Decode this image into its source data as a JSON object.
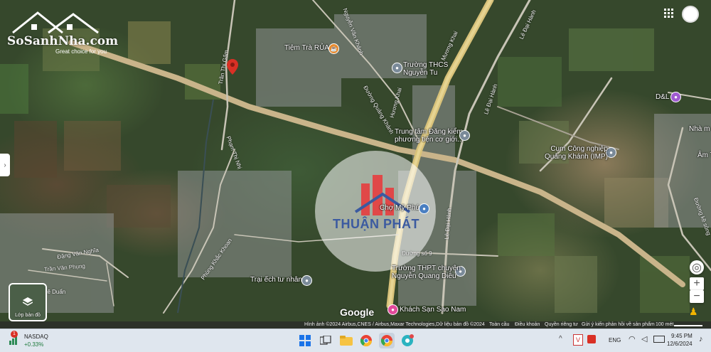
{
  "logo": {
    "brand": "SoSanhNha.com",
    "tagline": "Great choice for you"
  },
  "watermark": {
    "brand": "THUẬN PHÁT"
  },
  "places": {
    "tiem_tra": "Tiệm Trà RỦA",
    "truong_thcs": "Trường THCS\nNguyễn Tu",
    "trung_tam": "Trung tâm Đăng kiểm\nphương tiện cơ giới...",
    "cum_cong_nghiep": "Cụm Công nghiệp\nQuảng Khánh (IMP)",
    "d_l": "D&L",
    "nha_m": "Nhà m",
    "am": "Âm T",
    "cho": "Chợ Mỹ Phú",
    "truong_thpt": "Trường THPT chuyên\nNguyễn Quang Diêu",
    "trai_ech": "Trại ếch tư nhân",
    "khach_san": "Khách Sạn Sao Nam"
  },
  "roads": {
    "tran_thi_gam": "Trần Thị Gấm",
    "muong_khai": "Mương Khai",
    "le_dai_hanh_1": "Lê Đại Hành",
    "le_dai_hanh_2": "Lê Đại Hành",
    "le_dai_hanh_3": "Lê Đại Hành",
    "quang_khanh": "Đường Quảng Khánh",
    "huong_khai": "Hương Khai",
    "nguyen_van_khanh": "Nguyễn Văn Khánh",
    "pham_thi_nhi": "Phạm Thị Nhị",
    "phung_khac_khoan": "Phùng Khắc Khoan",
    "dang_van_nghia": "Đặng Văn Nghĩa",
    "tran_van_phung": "Trần Văn Phụng",
    "le_duan": "Lê Duẩn",
    "duong_so_9": "Đường số 9",
    "ke_song": "Đường kề sông"
  },
  "layer_button": {
    "label": "Lớp bản đồ"
  },
  "google": "Google",
  "attribution": {
    "imagery": "Hình ảnh ©2024 Airbus,CNES / Airbus,Maxar Technologies,Dữ liệu bản đồ ©2024",
    "zoom": "Toàn cầu",
    "terms": "Điều khoản",
    "privacy": "Quyền riêng tư",
    "feedback": "Gửi ý kiến phản hồi về sản phẩm",
    "scale": "100 mét"
  },
  "taskbar": {
    "stock_name": "NASDAQ",
    "stock_change": "+0.33%",
    "stock_badge": "1",
    "language": "ENG",
    "time": "9:45 PM",
    "date": "12/6/2024"
  },
  "colors": {
    "poi_blue": "#4a7fc1",
    "poi_gray": "#7a8a99",
    "poi_orange": "#e8892c",
    "poi_purple": "#a05bd1",
    "poi_pink": "#e24a9b",
    "pin_red": "#d93025"
  }
}
